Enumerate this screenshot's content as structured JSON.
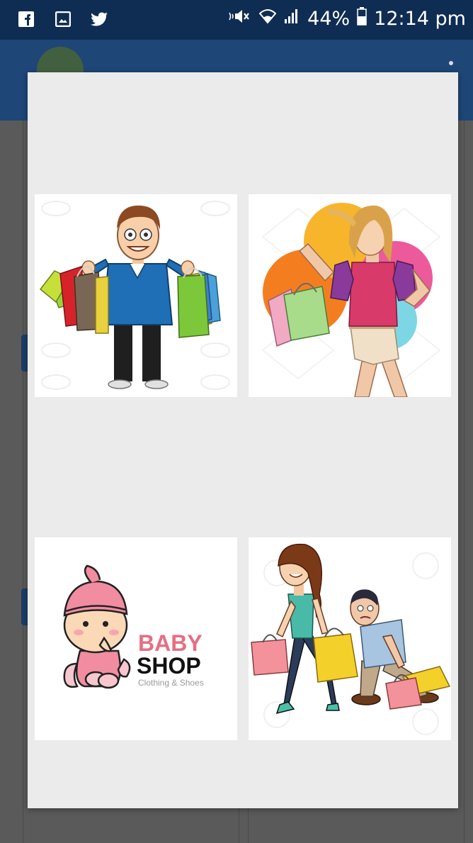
{
  "status_bar": {
    "left_icons": [
      "facebook-icon",
      "gallery-icon",
      "twitter-icon"
    ],
    "right_icons": [
      "mute-icon",
      "wifi-icon",
      "signal-icon",
      "battery-icon"
    ],
    "battery": "44%",
    "time": "12:14 pm"
  },
  "dialog": {
    "tiles": [
      {
        "name": "man-shopping-bags-image"
      },
      {
        "name": "woman-shopping-image"
      },
      {
        "name": "baby-shop-logo-image",
        "text_line1": "BABY",
        "text_line2": "SHOP",
        "text_line3": "Clothing & Shoes"
      },
      {
        "name": "couple-shopping-image"
      }
    ]
  },
  "colors": {
    "status_bar": "#0f2d52",
    "app_bar": "#1e4677",
    "dialog": "#ebebeb",
    "scrim": "#5a5a5a"
  }
}
